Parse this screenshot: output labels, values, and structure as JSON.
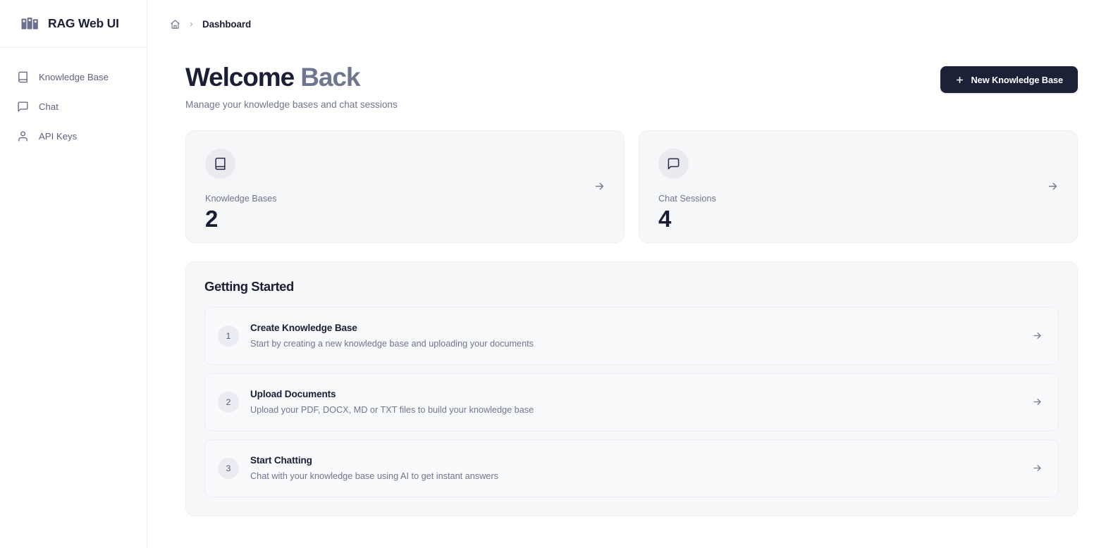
{
  "sidebar": {
    "brand": {
      "title": "RAG Web UI",
      "logo_icon": "library-logo-icon"
    },
    "items": [
      {
        "label": "Knowledge Base",
        "icon": "book-icon"
      },
      {
        "label": "Chat",
        "icon": "chat-bubble-icon"
      },
      {
        "label": "API Keys",
        "icon": "user-icon"
      }
    ]
  },
  "breadcrumb": {
    "home_icon": "home-icon",
    "separator_icon": "chevron-right-icon",
    "current": "Dashboard"
  },
  "header": {
    "title_primary": "Welcome ",
    "title_accent": "Back",
    "subtitle": "Manage your knowledge bases and chat sessions",
    "new_kb_button": "New Knowledge Base",
    "plus_icon": "plus-icon"
  },
  "stats": [
    {
      "label": "Knowledge Bases",
      "value": "2",
      "icon": "book-icon",
      "arrow_icon": "arrow-right-icon"
    },
    {
      "label": "Chat Sessions",
      "value": "4",
      "icon": "chat-bubble-icon",
      "arrow_icon": "arrow-right-icon"
    }
  ],
  "getting_started": {
    "title": "Getting Started",
    "steps": [
      {
        "number": "1",
        "title": "Create Knowledge Base",
        "description": "Start by creating a new knowledge base and uploading your documents",
        "arrow_icon": "arrow-right-icon"
      },
      {
        "number": "2",
        "title": "Upload Documents",
        "description": "Upload your PDF, DOCX, MD or TXT files to build your knowledge base",
        "arrow_icon": "arrow-right-icon"
      },
      {
        "number": "3",
        "title": "Start Chatting",
        "description": "Chat with your knowledge base using AI to get instant answers",
        "arrow_icon": "arrow-right-icon"
      }
    ]
  },
  "colors": {
    "ink": "#1b1f36",
    "muted": "#6f758e",
    "card_bg": "#f6f7f9",
    "button_bg": "#1d2138",
    "badge_bg": "#e9ebf0"
  }
}
